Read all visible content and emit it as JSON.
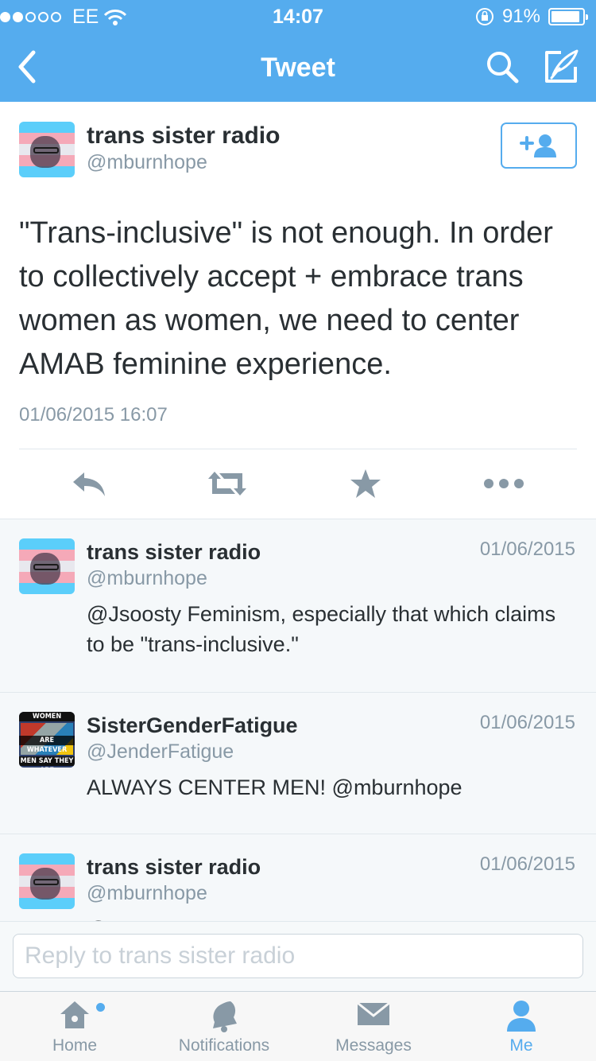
{
  "status_bar": {
    "carrier": "EE",
    "time": "14:07",
    "battery_percent": "91%",
    "battery_level": 0.91
  },
  "nav": {
    "title": "Tweet",
    "back_icon": "chevron-left-icon",
    "search_icon": "search-icon",
    "compose_icon": "compose-icon"
  },
  "main_tweet": {
    "name": "trans sister radio",
    "handle": "@mburnhope",
    "text": "\"Trans-inclusive\" is not enough. In order to collectively accept + embrace trans women as women, we need to center AMAB feminine experience.",
    "date": "01/06/2015 16:07",
    "follow_icon": "follow-user-icon"
  },
  "actions": [
    {
      "icon": "reply-icon"
    },
    {
      "icon": "retweet-icon"
    },
    {
      "icon": "favorite-star-icon"
    },
    {
      "icon": "more-icon"
    }
  ],
  "replies": [
    {
      "name": "trans sister radio",
      "handle": "@mburnhope",
      "date": "01/06/2015",
      "text": "@Jsoosty Feminism, especially that which claims to be \"trans-inclusive.\""
    },
    {
      "name": "SisterGenderFatigue",
      "handle": "@JenderFatigue",
      "date": "01/06/2015",
      "text": "ALWAYS CENTER MEN! @mburnhope",
      "avatar_text": [
        "WOMEN",
        "ARE WHATEVER",
        "MEN SAY THEY ARE"
      ]
    },
    {
      "name": "trans sister radio",
      "handle": "@mburnhope",
      "date": "01/06/2015",
      "text": "@Jsoosty Every trans woman + AMAB transmisogyny which is misogyny, needs to"
    }
  ],
  "composer": {
    "placeholder": "Reply to trans sister radio"
  },
  "tabs": [
    {
      "label": "Home",
      "icon": "home-icon",
      "active": false
    },
    {
      "label": "Notifications",
      "icon": "bell-icon",
      "active": false
    },
    {
      "label": "Messages",
      "icon": "envelope-icon",
      "active": false
    },
    {
      "label": "Me",
      "icon": "person-icon",
      "active": true
    }
  ],
  "colors": {
    "accent": "#55acee",
    "text": "#292f33",
    "muted": "#8899a6",
    "icon_gray": "#8899a6"
  }
}
